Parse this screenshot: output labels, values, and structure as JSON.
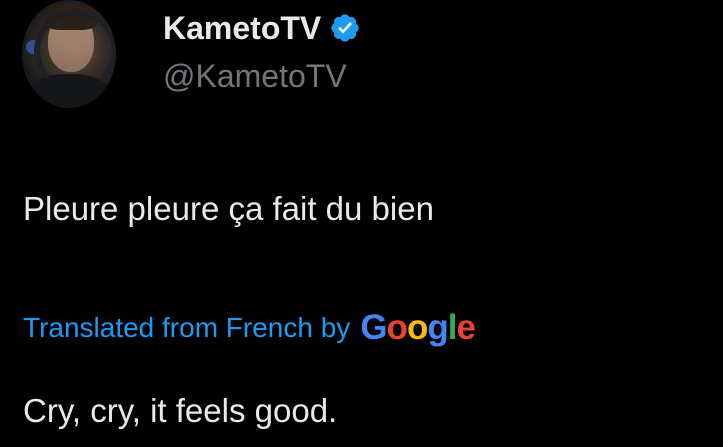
{
  "tweet": {
    "author": {
      "display_name": "KametoTV",
      "handle": "@KametoTV",
      "verified": true,
      "avatar_icon": "avatar-photo"
    },
    "text": "Pleure pleure ça fait du bien",
    "translation": {
      "label": "Translated from French by",
      "provider": "Google",
      "text": "Cry, cry, it feels good."
    }
  },
  "colors": {
    "background": "#000000",
    "primary_text": "#e7e9ea",
    "secondary_text": "#71767b",
    "link": "#1d9bf0",
    "verified_badge": "#1d9bf0",
    "google_blue": "#4285f4",
    "google_red": "#ea4335",
    "google_yellow": "#fbbc05",
    "google_green": "#34a853"
  }
}
